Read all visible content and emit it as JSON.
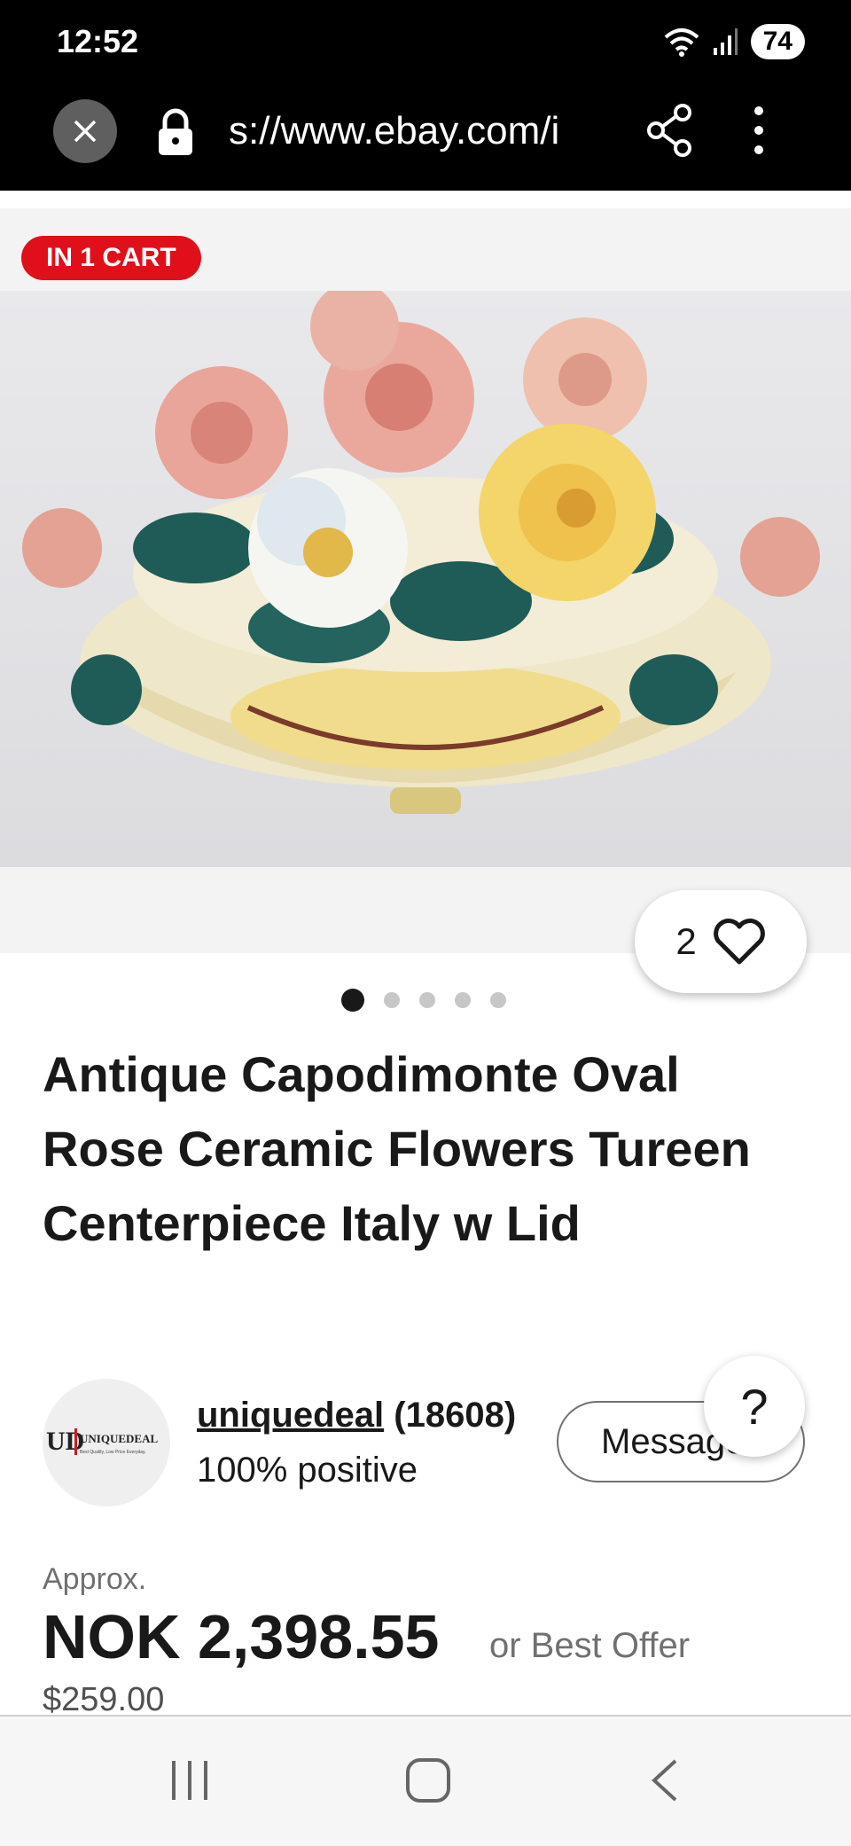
{
  "status_bar": {
    "time": "12:52",
    "battery": "74"
  },
  "browser": {
    "url": "s://www.ebay.com/i"
  },
  "badge": {
    "label": "IN 1 CART"
  },
  "watch": {
    "count": "2"
  },
  "gallery": {
    "total_images": 5,
    "active_index": 0
  },
  "listing": {
    "title": "Antique Capodimonte Oval Rose Ceramic Flowers Tureen Centerpiece Italy w Lid"
  },
  "seller": {
    "name": "uniquedeal",
    "feedback_count": "(18608)",
    "positive": "100% positive",
    "avatar_text": "UNIQUEDEAL",
    "avatar_tagline": "Best Quality, Low Price Everyday.",
    "message_label": "Message"
  },
  "help": {
    "label": "?"
  },
  "price": {
    "approx_label": "Approx.",
    "amount": "NOK 2,398.55",
    "best_offer": "or Best Offer",
    "usd": "$259.00"
  },
  "colors": {
    "badge": "#e0101b",
    "text": "#191919",
    "muted": "#707070"
  }
}
